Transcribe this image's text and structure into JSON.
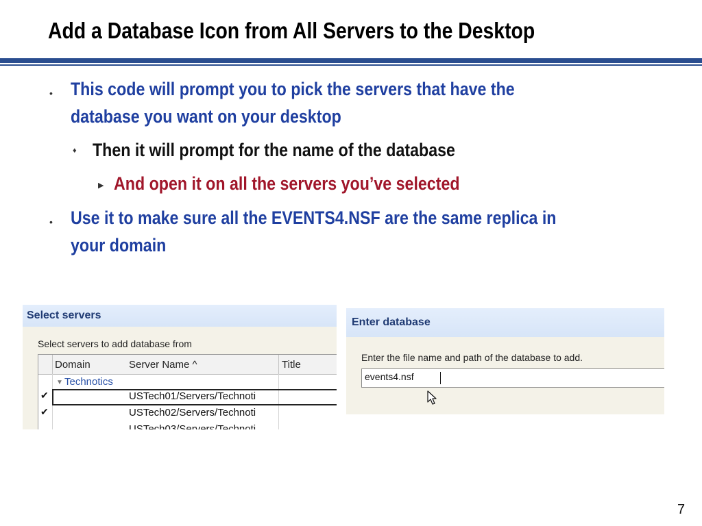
{
  "slide": {
    "title": "Add a Database Icon from All Servers to the Desktop",
    "page_number": "7",
    "colors": {
      "accent_bar": "#2a4d8f",
      "bullet_blue": "#1f3fa0",
      "bullet_red": "#a0162a"
    }
  },
  "bullets": {
    "b1_line1": "This code will prompt you to pick the servers that have the",
    "b1_line2": "database you want on your desktop",
    "b1_sub": "Then it will prompt for the name of the database",
    "b1_subsub": "And open it on all the servers you’ve selected",
    "b2_line1": "Use it to make sure all the EVENTS4.NSF are the same replica in",
    "b2_line2": "your domain",
    "markers": {
      "level1": "•",
      "level2": "♦",
      "level3": "▶"
    }
  },
  "select_servers_dialog": {
    "title": "Select servers",
    "prompt": "Select servers to add database from",
    "columns": {
      "domain": "Domain",
      "server_name": "Server Name ^",
      "title": "Title"
    },
    "group": "Technotics",
    "rows": [
      {
        "checked": "✔",
        "server": "USTech01/Servers/Technoti"
      },
      {
        "checked": "✔",
        "server": "USTech02/Servers/Technoti"
      },
      {
        "checked": "",
        "server": "USTech03/Servers/Technoti"
      }
    ]
  },
  "enter_database_dialog": {
    "title": "Enter database",
    "prompt": "Enter the file name and path of the database to add.",
    "input_value": "events4.nsf"
  }
}
